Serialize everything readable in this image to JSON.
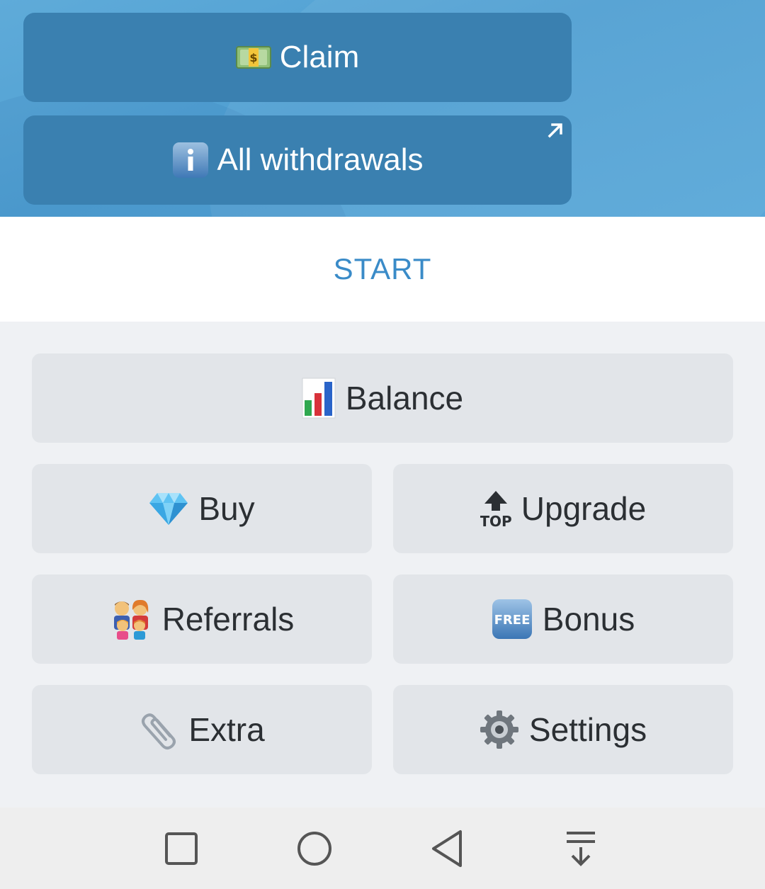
{
  "inline_buttons": {
    "claim": {
      "label": "Claim",
      "icon": "money-bill-icon"
    },
    "withdrawals": {
      "label": "All withdrawals",
      "icon": "info-icon",
      "link_icon": "external-arrow-icon"
    }
  },
  "start": {
    "label": "START"
  },
  "keyboard": {
    "balance": {
      "label": "Balance",
      "icon": "bar-chart-icon"
    },
    "buy": {
      "label": "Buy",
      "icon": "gem-icon"
    },
    "upgrade": {
      "label": "Upgrade",
      "icon": "top-arrow-icon",
      "icon_text": "TOP"
    },
    "referrals": {
      "label": "Referrals",
      "icon": "family-icon"
    },
    "bonus": {
      "label": "Bonus",
      "icon": "free-icon",
      "icon_text": "FREE"
    },
    "extra": {
      "label": "Extra",
      "icon": "paperclip-icon"
    },
    "settings": {
      "label": "Settings",
      "icon": "gear-icon"
    }
  },
  "navbar": {
    "items": [
      "recent-apps",
      "home",
      "back",
      "hide-keyboard"
    ]
  },
  "colors": {
    "chat_bg": "#58a7d8",
    "inline_button": "#3a80b0",
    "start_text": "#3a8bc8",
    "keyboard_bg": "#eff1f4",
    "keyboard_button": "#e2e5e9"
  }
}
